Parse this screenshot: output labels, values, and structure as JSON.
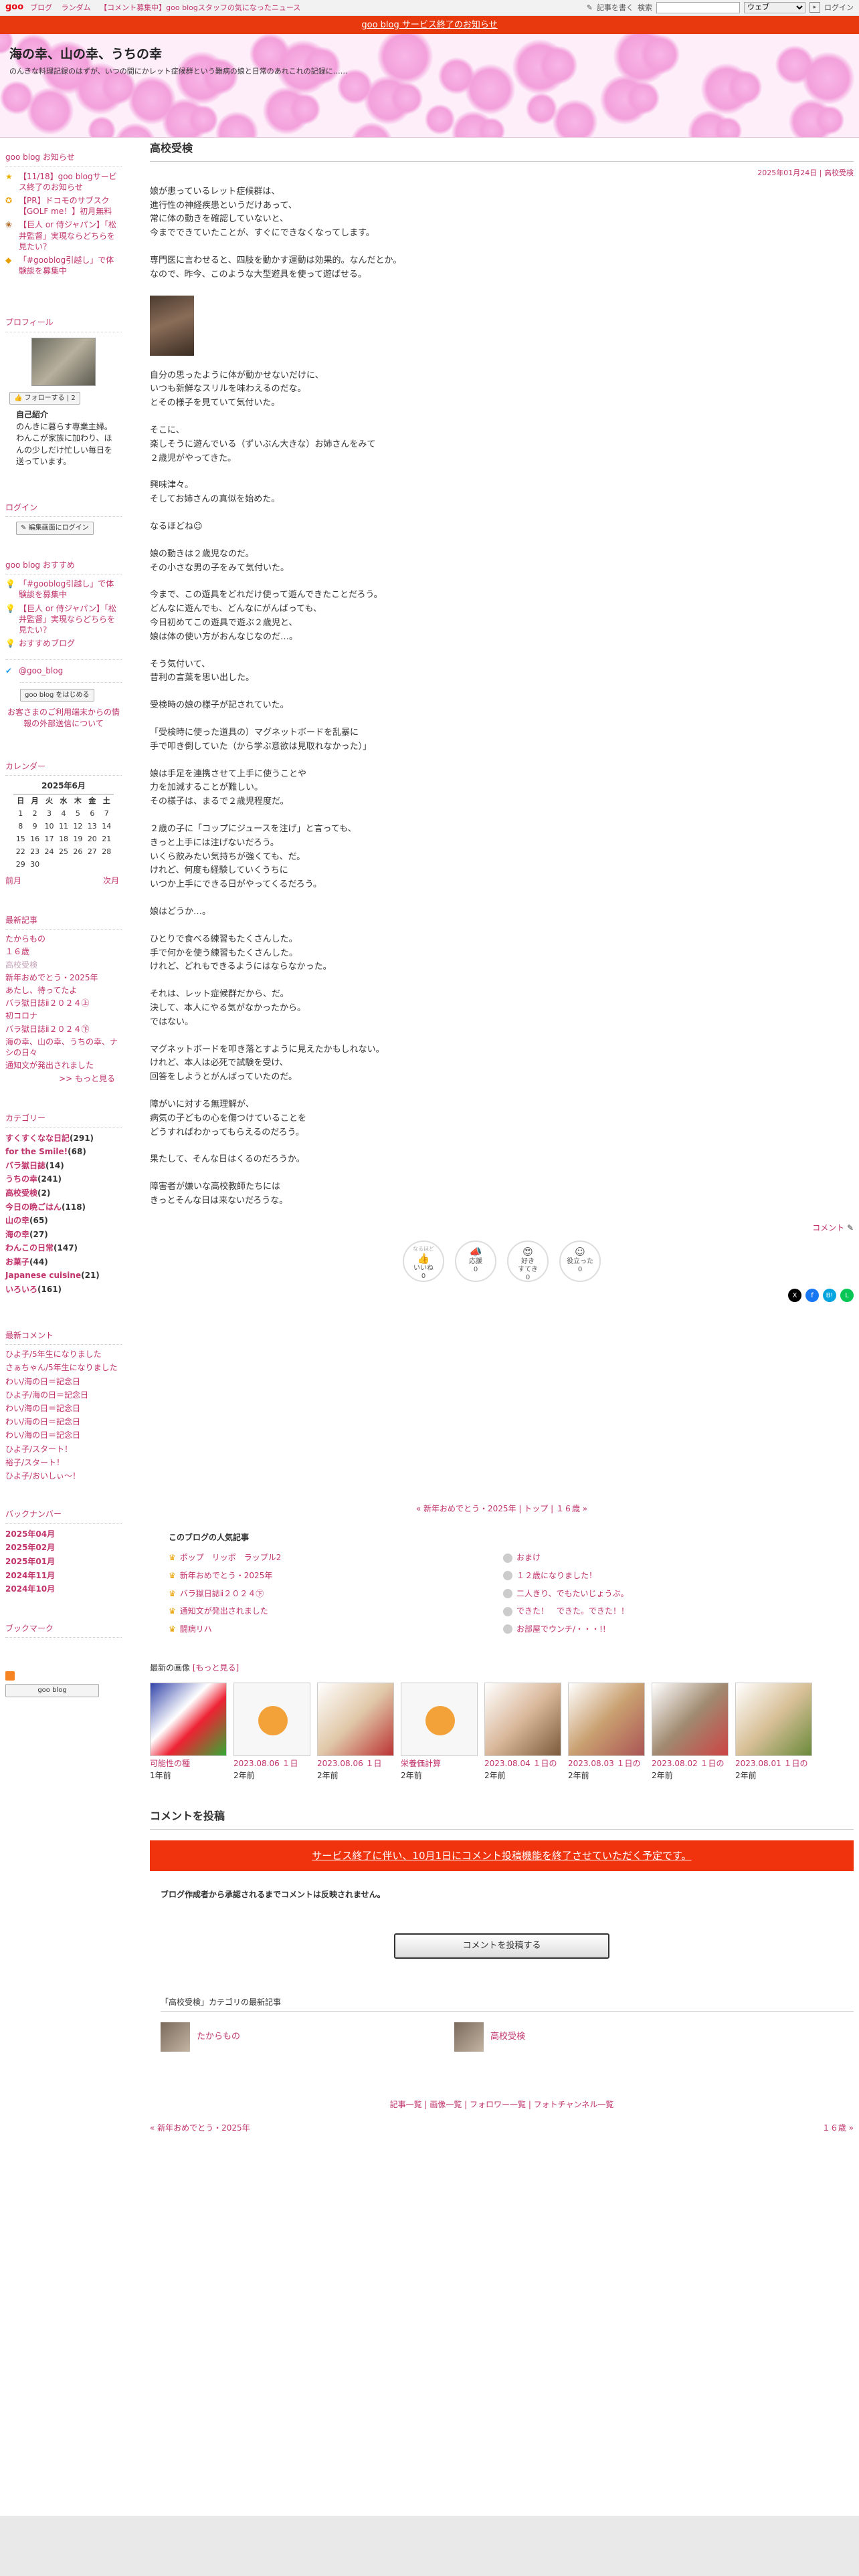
{
  "topbar": {
    "logo": "goo",
    "nav": [
      "ブログ",
      "ランダム",
      "【コメント募集中】goo blogスタッフの気になったニュース"
    ],
    "write": "記事を書く",
    "search_label": "検索",
    "search_placeholder": "",
    "search_scope": "ウェブ",
    "login": "ログイン"
  },
  "notice_bar": "goo blog サービス終了のお知らせ",
  "header": {
    "title": "海の幸、山の幸、うちの幸",
    "description": "のんきな料理記録のはずが、いつの間にかレット症候群という難病の娘と日常のあれこれの記録に……"
  },
  "sidebar": {
    "info_title": "goo blog お知らせ",
    "info_items": [
      {
        "icon": "star-icon",
        "text": "【11/18】goo blogサービス終了のお知らせ"
      },
      {
        "icon": "ribbon-icon",
        "text": "【PR】ドコモのサブスク【GOLF me！】初月無料"
      },
      {
        "icon": "dog-icon",
        "text": "【巨人 or 侍ジャパン】「松井監督」実現ならどちらを見たい？"
      },
      {
        "icon": "tag-icon",
        "text": "「#gooblog引越し」で体験談を募集中"
      }
    ],
    "profile_title": "プロフィール",
    "follow_label": "フォローする",
    "follow_count": "2",
    "intro_label": "自己紹介",
    "intro_text": "のんきに暮らす専業主婦。わんこが家族に加わり、ほんの少しだけ忙しい毎日を送っています。",
    "login_title": "ログイン",
    "login_button": "編集画面にログイン",
    "recommend_title": "goo blog おすすめ",
    "recommend_items": [
      "「#gooblog引越し」で体験談を募集中",
      "【巨人 or 侍ジャパン】「松井監督」実現ならどちらを見たい？",
      "おすすめブログ"
    ],
    "twitter": "@goo_blog",
    "start_button": "goo blog をはじめる",
    "external_notice": "お客さまのご利用端末からの情報の外部送信について",
    "calendar_title": "カレンダー",
    "calendar_month": "2025年6月",
    "calendar_days": [
      "日",
      "月",
      "火",
      "水",
      "木",
      "金",
      "土"
    ],
    "calendar_weeks": [
      [
        "1",
        "2",
        "3",
        "4",
        "5",
        "6",
        "7"
      ],
      [
        "8",
        "9",
        "10",
        "11",
        "12",
        "13",
        "14"
      ],
      [
        "15",
        "16",
        "17",
        "18",
        "19",
        "20",
        "21"
      ],
      [
        "22",
        "23",
        "24",
        "25",
        "26",
        "27",
        "28"
      ],
      [
        "29",
        "30",
        "",
        "",
        "",
        "",
        ""
      ]
    ],
    "calendar_prev": "前月",
    "calendar_next": "次月",
    "recent_title": "最新記事",
    "recent_items": [
      "たからもの",
      "１６歳",
      "高校受検",
      "新年おめでとう・2025年",
      "あたし、待ってたよ",
      "バラ獄日誌ⅱ２０２４㊤",
      "初コロナ",
      "バラ獄日誌ⅱ２０２４㊦",
      "海の幸、山の幸、うちの幸、ナシの日々",
      "通知文が発出されました"
    ],
    "recent_more": ">> もっと見る",
    "category_title": "カテゴリー",
    "categories": [
      {
        "name": "すくすくなな日記",
        "count": "(291)"
      },
      {
        "name": "for the Smile!",
        "count": "(68)"
      },
      {
        "name": "バラ獄日誌",
        "count": "(14)"
      },
      {
        "name": "うちの幸",
        "count": "(241)"
      },
      {
        "name": "高校受検",
        "count": "(2)"
      },
      {
        "name": "今日の晩ごはん",
        "count": "(118)"
      },
      {
        "name": "山の幸",
        "count": "(65)"
      },
      {
        "name": "海の幸",
        "count": "(27)"
      },
      {
        "name": "わんこの日常",
        "count": "(147)"
      },
      {
        "name": "お菓子",
        "count": "(44)"
      },
      {
        "name": "Japanese cuisine",
        "count": "(21)"
      },
      {
        "name": "いろいろ",
        "count": "(161)"
      }
    ],
    "comment_title": "最新コメント",
    "comments": [
      "ひよ子/5年生になりました",
      "さぁちゃん/5年生になりました",
      "わい/海の日＝記念日",
      "ひよ子/海の日＝記念日",
      "わい/海の日＝記念日",
      "わい/海の日＝記念日",
      "わい/海の日＝記念日",
      "ひよ子/スタート！",
      "裕子/スタート！",
      "ひよ子/おいしぃ〜！"
    ],
    "backnumber_title": "バックナンバー",
    "backnumbers": [
      "2025年04月",
      "2025年02月",
      "2025年01月",
      "2024年11月",
      "2024年10月"
    ],
    "bookmark_title": "ブックマーク",
    "rss_badge": "goo blog"
  },
  "entry": {
    "title": "高校受検",
    "date": "2025年01月24日",
    "category": "高校受検",
    "paragraphs": [
      "娘が患っているレット症候群は、\n進行性の神経疾患というだけあって、\n常に体の動きを確認していないと、\n今までできていたことが、すぐにできなくなってします。",
      "専門医に言わせると、四肢を動かす運動は効果的。なんだとか。\nなので、昨今、このような大型遊具を使って遊ばせる。",
      "自分の思ったように体が動かせないだけに、\nいつも新鮮なスリルを味わえるのだな。\nとその様子を見ていて気付いた。",
      "そこに、\n楽しそうに遊んでいる（ずいぶん大きな）お姉さんをみて\n２歳児がやってきた。",
      "興味津々。\nそしてお姉さんの真似を始めた。",
      "なるほどね☺",
      "娘の動きは２歳児なのだ。\nその小さな男の子をみて気付いた。",
      "今まで、この遊具をどれだけ使って遊んできたことだろう。\nどんなに遊んでも、どんなにがんばっても、\n今日初めてこの遊具で遊ぶ２歳児と、\n娘は体の使い方がおんなじなのだ…。",
      "そう気付いて、\n昔利の言葉を思い出した。",
      "受検時の娘の様子が記されていた。",
      "「受検時に使った道具の）マグネットボードを乱暴に\n手で叩き倒していた（から学ぶ意欲は見取れなかった）」",
      "娘は手足を連携させて上手に使うことや\n力を加減することが難しい。\nその様子は、まるで２歳児程度だ。",
      "２歳の子に「コップにジュースを注げ」と言っても、\nきっと上手には注げないだろう。\nいくら飲みたい気持ちが強くても、だ。\nけれど、何度も経験していくうちに\nいつか上手にできる日がやってくるだろう。",
      "娘はどうか…。",
      "ひとりで食べる練習もたくさんした。\n手で何かを使う練習もたくさんした。\nけれど、どれもできるようにはならなかった。",
      "それは、レット症候群だから、だ。\n決して、本人にやる気がなかったから。\nではない。",
      "マグネットボードを叩き落とすように見えたかもしれない。\nけれど、本人は必死で試験を受け、\n回答をしようとがんばっていたのだ。",
      "障がいに対する無理解が、\n病気の子どもの心を傷つけていることを\nどうすればわかってもらえるのだろう。",
      "果たして、そんな日はくるのだろうか。",
      "障害者が嫌いな高校教師たちには\nきっとそんな日は来ないだろうな。"
    ],
    "comment_link": "コメント"
  },
  "reactions": [
    {
      "top": "なるほど",
      "icon": "thumbs-up-icon",
      "label": "いいね",
      "count": "0"
    },
    {
      "top": "",
      "icon": "megaphone-icon",
      "label": "応援",
      "count": "0"
    },
    {
      "top": "",
      "icon": "heart-eyes-icon",
      "label": "好き\nすてき",
      "count": "0"
    },
    {
      "top": "",
      "icon": "smile-icon",
      "label": "役立った",
      "count": "0"
    }
  ],
  "share": {
    "x": "X",
    "facebook": "f",
    "hatena": "B!",
    "line": "L"
  },
  "pager": {
    "prev": "« 新年おめでとう・2025年",
    "top": "トップ",
    "next": "１６歳 »"
  },
  "popular": {
    "title": "このブログの人気記事",
    "left": [
      "ポップ　リッポ　ラップル2",
      "新年おめでとう・2025年",
      "バラ獄日誌ⅱ２０２４㊦",
      "通知文が発出されました",
      "闘病リハ"
    ],
    "right": [
      "おまけ",
      "１２歳になりました！",
      "二人きり、でもたいじょうぶ。",
      "できた！　できた。できた！！",
      "お部屋でウンチ/・・・!!"
    ]
  },
  "latest_images": {
    "title": "最新の画像",
    "more": "[もっと見る]",
    "items": [
      {
        "title": "可能性の種",
        "ago": "1年前"
      },
      {
        "title": "2023.08.06 １日",
        "ago": "2年前"
      },
      {
        "title": "2023.08.06 １日",
        "ago": "2年前"
      },
      {
        "title": "栄養価計算",
        "ago": "2年前"
      },
      {
        "title": "2023.08.04 １日の",
        "ago": "2年前"
      },
      {
        "title": "2023.08.03 １日の",
        "ago": "2年前"
      },
      {
        "title": "2023.08.02 １日の",
        "ago": "2年前"
      },
      {
        "title": "2023.08.01 １日の",
        "ago": "2年前"
      }
    ]
  },
  "comment_section": {
    "title": "コメントを投稿",
    "banner": "サービス終了に伴い、10月1日にコメント投稿機能を終了させていただく予定です。",
    "approval": "ブログ作成者から承認されるまでコメントは反映されません。",
    "post_button": "コメントを投稿する"
  },
  "category_latest": {
    "title": "「高校受検」カテゴリの最新記事",
    "items": [
      "たからもの",
      "高校受検"
    ]
  },
  "footer_links": "記事一覧 | 画像一覧 | フォロワー一覧 | フォトチャンネル一覧",
  "bottom_pager": {
    "prev": "« 新年おめでとう・2025年",
    "next": "１６歳 »"
  }
}
